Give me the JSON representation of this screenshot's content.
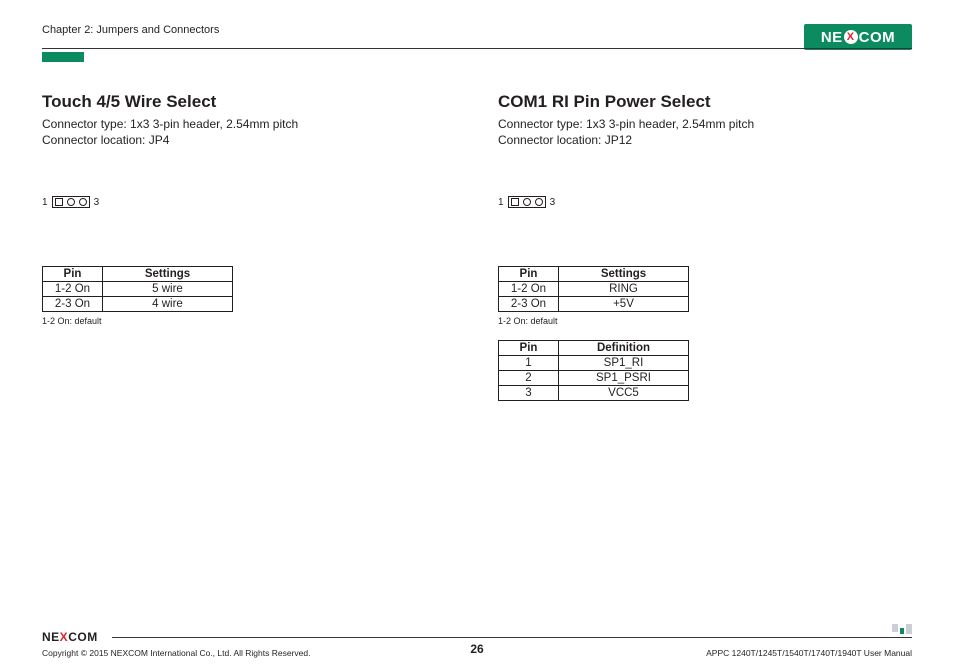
{
  "header": {
    "chapter": "Chapter 2: Jumpers and Connectors",
    "logo_pre": "NE",
    "logo_x": "X",
    "logo_post": "COM"
  },
  "left": {
    "title": "Touch 4/5 Wire Select",
    "sub1": "Connector type: 1x3 3-pin header, 2.54mm pitch",
    "sub2": "Connector location: JP4",
    "pin_left": "1",
    "pin_right": "3",
    "tbl": {
      "h1": "Pin",
      "h2": "Settings",
      "r1c1": "1-2 On",
      "r1c2": "5 wire",
      "r2c1": "2-3 On",
      "r2c2": "4 wire"
    },
    "note": "1-2 On: default"
  },
  "right": {
    "title": "COM1 RI Pin Power Select",
    "sub1": "Connector type: 1x3 3-pin header, 2.54mm pitch",
    "sub2": "Connector location: JP12",
    "pin_left": "1",
    "pin_right": "3",
    "tbl": {
      "h1": "Pin",
      "h2": "Settings",
      "r1c1": "1-2 On",
      "r1c2": "RING",
      "r2c1": "2-3 On",
      "r2c2": "+5V"
    },
    "note": "1-2 On: default",
    "tbl2": {
      "h1": "Pin",
      "h2": "Definition",
      "r1c1": "1",
      "r1c2": "SP1_RI",
      "r2c1": "2",
      "r2c2": "SP1_PSRI",
      "r3c1": "3",
      "r3c2": "VCC5"
    }
  },
  "footer": {
    "logo_pre": "NE",
    "logo_x": "X",
    "logo_post": "COM",
    "copyright": "Copyright © 2015 NEXCOM International Co., Ltd. All Rights Reserved.",
    "page": "26",
    "manual": "APPC 1240T/1245T/1540T/1740T/1940T User Manual"
  }
}
